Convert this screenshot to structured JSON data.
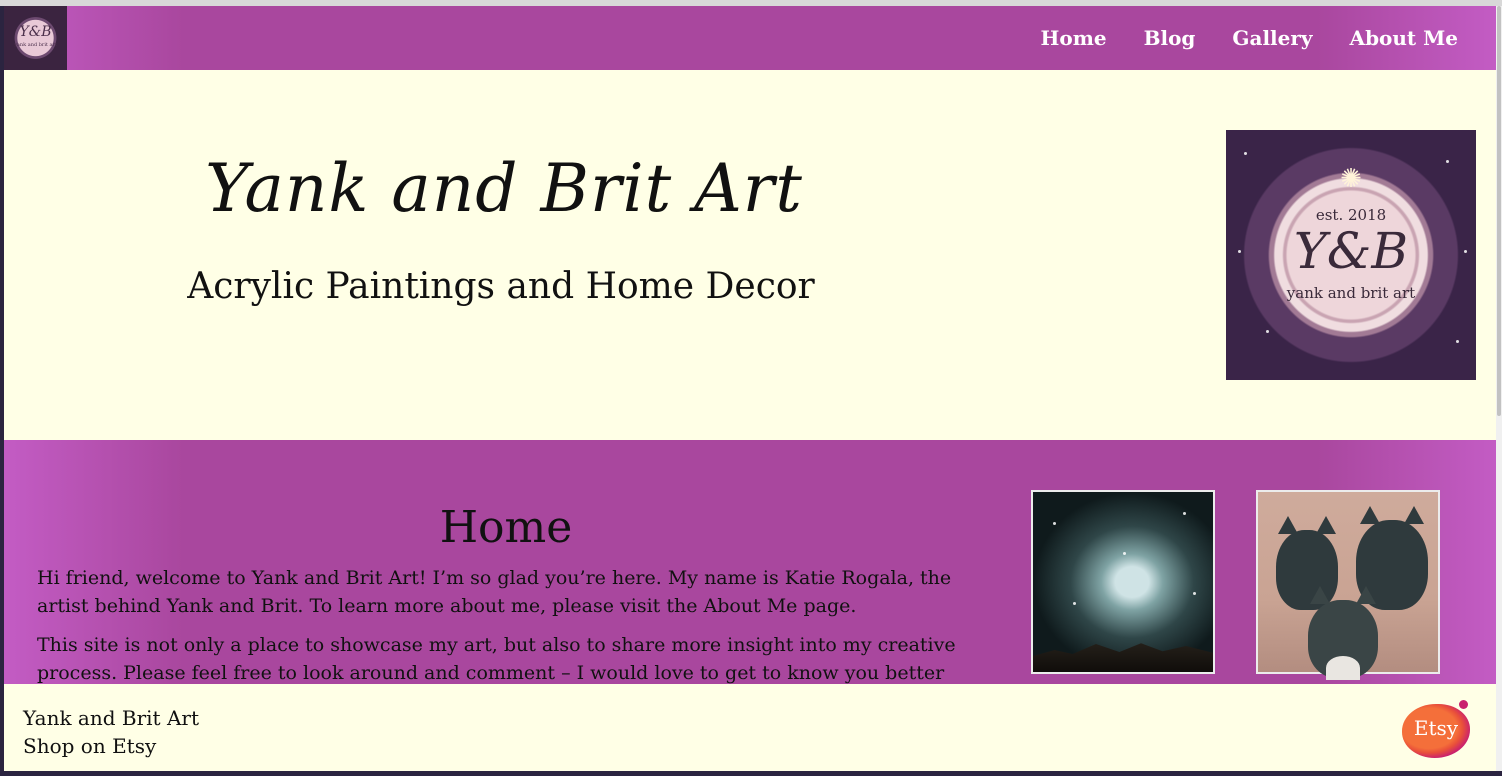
{
  "nav": {
    "logo_text": "Y&B",
    "logo_subtext": "yank and brit art",
    "links": [
      {
        "label": "Home"
      },
      {
        "label": "Blog"
      },
      {
        "label": "Gallery"
      },
      {
        "label": "About Me"
      }
    ]
  },
  "hero": {
    "title": "Yank and Brit Art",
    "tagline": "Acrylic Paintings and Home Decor",
    "logo": {
      "est": "est. 2018",
      "monogram": "Y&B",
      "name": "yank and brit art"
    }
  },
  "main": {
    "heading": "Home",
    "paragraphs": [
      "Hi friend, welcome to Yank and Brit Art! I’m so glad you’re here. My name is Katie Rogala, the artist behind Yank and Brit. To learn more about me, please visit the About Me page.",
      "This site is not only a place to showcase my art, but also to share more insight into my creative process. Please feel free to look around and comment – I would love to get to know you better and"
    ]
  },
  "footer": {
    "site_name": "Yank and Brit Art",
    "etsy_link": "Shop on Etsy",
    "etsy_badge": "Etsy"
  },
  "colors": {
    "accent": "#a9479e",
    "accent_edge": "#c35cc4",
    "background": "#ffffe6"
  }
}
